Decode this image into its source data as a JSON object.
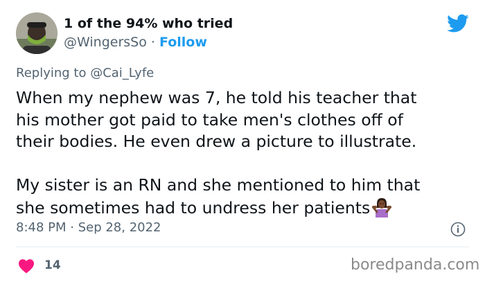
{
  "author": {
    "display_name": "1 of the 94% who tried",
    "handle": "@WingersSo",
    "separator": "·",
    "follow_label": "Follow"
  },
  "reply": {
    "prefix": "Replying to ",
    "mention": "@Cai_Lyfe"
  },
  "tweet": {
    "lines": [
      "When my nephew was 7, he told his teacher that",
      "his mother got paid to take men's clothes off of",
      "their bodies. He even drew a picture to illustrate.",
      "",
      "My sister is an RN and she mentioned to him that",
      "she sometimes had to undress her patients"
    ],
    "emoji_icon": "woman-shrugging-icon"
  },
  "meta": {
    "timestamp": "8:48 PM · Sep 28, 2022"
  },
  "engagement": {
    "likes": "14"
  },
  "watermark": "boredpanda.com",
  "colors": {
    "twitter_blue": "#1d9bf0",
    "heart_pink": "#f91880",
    "text_primary": "#0f1419",
    "text_secondary": "#536471"
  }
}
